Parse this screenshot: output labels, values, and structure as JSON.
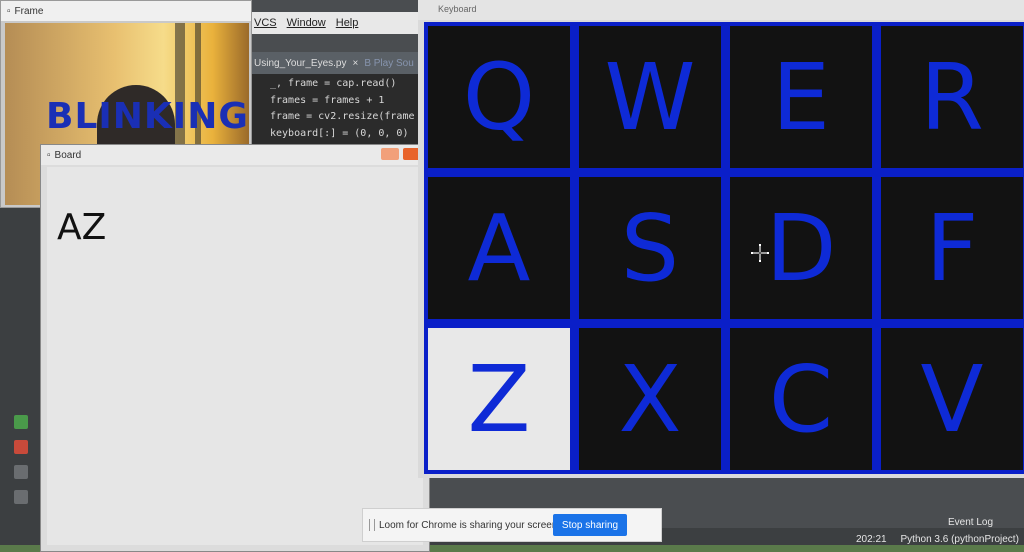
{
  "ide": {
    "menu": [
      "VCS",
      "Window",
      "Help"
    ],
    "tabs": [
      "Using_Your_Eyes.py",
      "B Play Sou"
    ],
    "code_lines": [
      "_, frame = cap.read()",
      "frames = frames + 1",
      "frame = cv2.resize(frame",
      "keyboard[:] = (0, 0, 0)"
    ],
    "event_log": "Event Log",
    "status_position": "202:21",
    "status_interpreter": "Python 3.6 (pythonProject)"
  },
  "frame_window": {
    "title": "Frame",
    "overlay_text": "BLINKING"
  },
  "board_window": {
    "title": "Board",
    "typed_text": "AZ"
  },
  "keyboard_window": {
    "title": "Keyboard",
    "keys": [
      {
        "label": "Q",
        "active": false
      },
      {
        "label": "W",
        "active": false
      },
      {
        "label": "E",
        "active": false
      },
      {
        "label": "R",
        "active": false
      },
      {
        "label": "A",
        "active": false
      },
      {
        "label": "S",
        "active": false
      },
      {
        "label": "D",
        "active": false
      },
      {
        "label": "F",
        "active": false
      },
      {
        "label": "Z",
        "active": true
      },
      {
        "label": "X",
        "active": false
      },
      {
        "label": "C",
        "active": false
      },
      {
        "label": "V",
        "active": false
      }
    ]
  },
  "loom_bar": {
    "message": "Loom for Chrome is sharing your screen.",
    "stop_label": "Stop sharing"
  },
  "colors": {
    "key_text": "#0e2ad6",
    "grid_border": "#0a1fc8",
    "key_bg": "#121212",
    "key_active_bg": "#e8e8e8",
    "blinking_text": "#1a2fb5",
    "stop_button": "#1a73e8"
  }
}
